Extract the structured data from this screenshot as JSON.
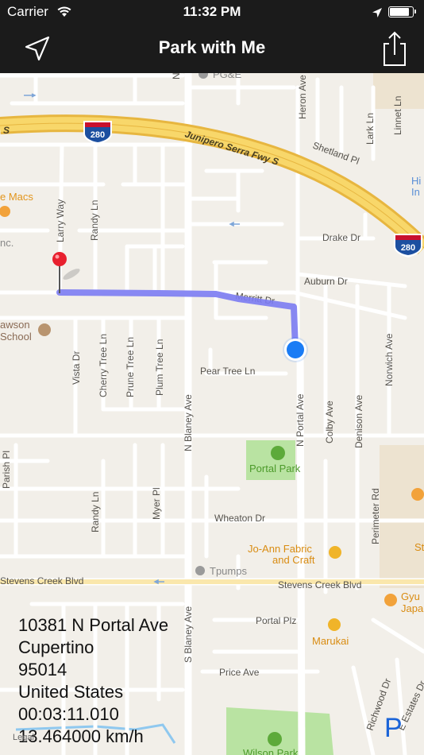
{
  "status_bar": {
    "carrier": "Carrier",
    "time": "11:32 PM",
    "wifi_icon": "wifi-icon",
    "location_icon": "location-arrow-icon",
    "battery_icon": "battery-icon"
  },
  "nav_bar": {
    "title": "Park with Me",
    "left_icon": "locate-arrow-icon",
    "right_icon": "share-icon"
  },
  "map": {
    "highways": {
      "i280_shield_1": "280",
      "i280_shield_2": "280",
      "fwy_name": "Junipero Serra Fwy S",
      "fwy_s": "S"
    },
    "streets": {
      "larry_way": "Larry Way",
      "randy_ln_top": "Randy Ln",
      "heron_ave": "Heron Ave",
      "lark_ln": "Lark Ln",
      "linnet_ln": "Linnet Ln",
      "shetland_pl": "Shetland Pl",
      "drake_dr": "Drake Dr",
      "auburn_dr": "Auburn Dr",
      "merritt_dr": "Merritt Dr",
      "vista_dr": "Vista Dr",
      "cherry_tree_ln": "Cherry Tree Ln",
      "prune_tree_ln": "Prune Tree Ln",
      "plum_tree_ln": "Plum Tree Ln",
      "pear_tree_ln": "Pear Tree Ln",
      "n_blaney_ave": "N Blaney Ave",
      "n_portal_ave": "N Portal Ave",
      "colby_ave": "Colby Ave",
      "denison_ave": "Denison Ave",
      "norwich_ave": "Norwich Ave",
      "parish_pl": "Parish Pl",
      "randy_ln_bottom": "Randy Ln",
      "myer_pl": "Myer Pl",
      "wheaton_dr": "Wheaton Dr",
      "perimeter_rd": "Perimeter Rd",
      "stevens_creek_blvd_left": "Stevens Creek Blvd",
      "stevens_creek_blvd_right": "Stevens Creek Blvd",
      "s_blaney_ave": "S Blaney Ave",
      "portal_plz": "Portal Plz",
      "price_ave": "Price Ave",
      "richwood_dr": "Richwood Dr",
      "e_estates_dr": "E Estates Dr",
      "n_label": "N"
    },
    "pois": {
      "pge": "PG&E",
      "the_macs": "e Macs",
      "inc": "nc.",
      "dawson_school_1": "awson",
      "dawson_school_2": "School",
      "portal_park": "Portal Park",
      "joann_1": "Jo-Ann Fabric",
      "joann_2": "and Craft",
      "tpumps": "Tpumps",
      "gyu_1": "Gyu",
      "gyu_2": "Japa",
      "marukai": "Marukai",
      "hi_1": "Hi",
      "hi_2": "In",
      "st": "St",
      "wilson_park": "Wilson Park"
    },
    "pin_icon": "red-pin-icon",
    "user_location_icon": "user-location-dot-icon",
    "route_color": "#6e6ef5"
  },
  "info": {
    "street": "10381 N Portal Ave",
    "city": "Cupertino",
    "zip": "95014",
    "country": "United States",
    "elapsed": "00:03:11.010",
    "speed": "13.464000 km/h"
  },
  "legal": "Legal",
  "parking_label": "P"
}
